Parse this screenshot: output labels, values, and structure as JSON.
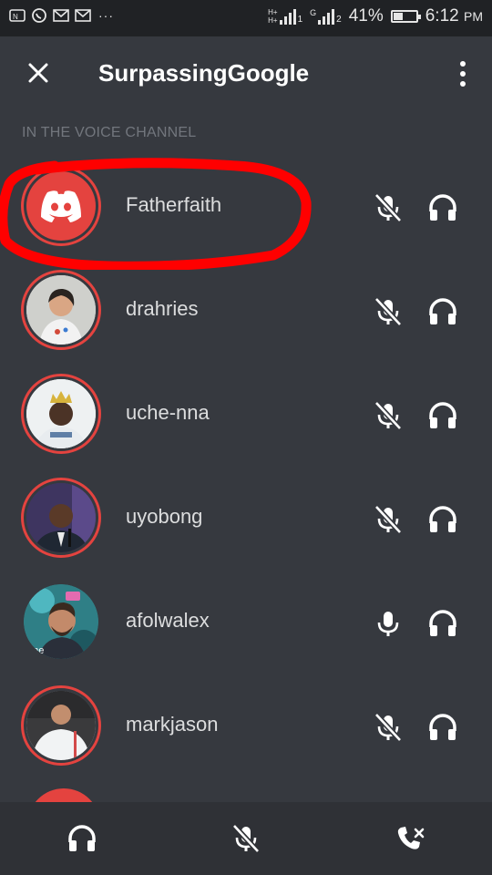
{
  "status_bar": {
    "notification_icons": [
      "nfc-icon",
      "whatsapp-icon",
      "gmail-icon",
      "gmail-icon"
    ],
    "overflow": "···",
    "network_1": "H+",
    "network_2": "H+",
    "sim_1": "1",
    "network_3": "G",
    "sim_2": "2",
    "battery": "41%",
    "battery_level": 0.41,
    "time": "6:12",
    "ampm": "PM"
  },
  "header": {
    "title": "SurpassingGoogle",
    "close_icon": "close-icon",
    "more_icon": "more-vertical-icon"
  },
  "section_label": "IN THE VOICE CHANNEL",
  "members": [
    {
      "name": "Fatherfaith",
      "avatar": "discord-logo-avatar",
      "mic": "mic-muted-icon",
      "headphones": "headphones-icon"
    },
    {
      "name": "drahries",
      "avatar": "photo-avatar",
      "mic": "mic-muted-icon",
      "headphones": "headphones-icon"
    },
    {
      "name": "uche-nna",
      "avatar": "photo-avatar",
      "mic": "mic-muted-icon",
      "headphones": "headphones-icon"
    },
    {
      "name": "uyobong",
      "avatar": "photo-avatar",
      "mic": "mic-muted-icon",
      "headphones": "headphones-icon"
    },
    {
      "name": "afolwalex",
      "avatar": "photo-avatar",
      "mic": "mic-icon",
      "headphones": "headphones-icon"
    },
    {
      "name": "markjason",
      "avatar": "photo-avatar",
      "mic": "mic-muted-icon",
      "headphones": "headphones-icon"
    }
  ],
  "bottom_bar": {
    "deafen": "headphones-icon",
    "mute": "mic-muted-icon",
    "disconnect": "hang-up-icon"
  },
  "colors": {
    "background": "#36393f",
    "status_bar": "#202225",
    "bottom_bar": "#2f3136",
    "accent_red": "#e4433f",
    "highlight_red": "#ff0000",
    "section_label": "#72767d"
  }
}
